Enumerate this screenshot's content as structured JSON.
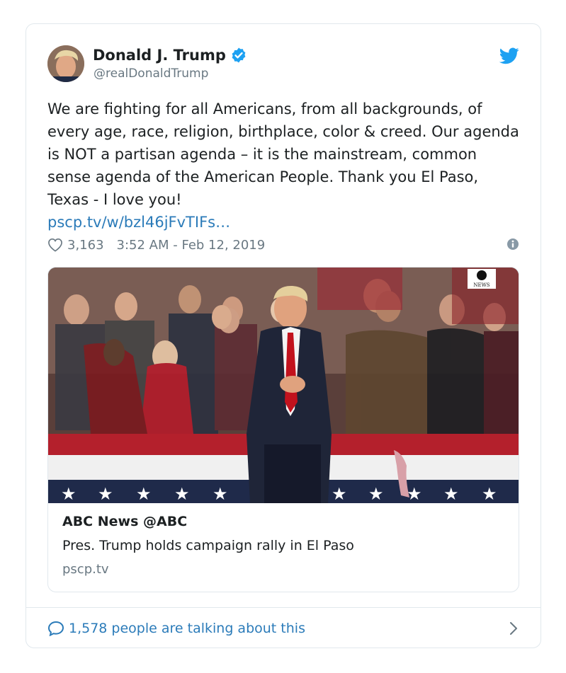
{
  "author": {
    "name": "Donald J. Trump",
    "handle": "@realDonaldTrump"
  },
  "tweet": {
    "text": "We are fighting for all Americans, from all backgrounds, of every age, race, religion, birthplace, color & creed. Our agenda is NOT a partisan agenda – it is the mainstream, common sense agenda of the American People. Thank you El Paso, Texas - I love you!",
    "link": "pscp.tv/w/bzl46jFvTIFs…",
    "likes": "3,163",
    "timestamp": "3:52 AM - Feb 12, 2019"
  },
  "media": {
    "badge": "NEWS",
    "source": "ABC News @ABC",
    "title": "Pres. Trump holds campaign rally in El Paso",
    "domain": "pscp.tv"
  },
  "footer": {
    "talking": "1,578 people are talking about this"
  },
  "icons": {
    "verified": "verified-badge-icon",
    "bird": "twitter-bird-icon",
    "heart": "heart-icon",
    "info": "info-icon",
    "bubble": "comment-bubble-icon",
    "chevron": "chevron-right-icon"
  },
  "colors": {
    "brand_blue": "#1da1f2",
    "link_blue": "#2b7bb9",
    "text": "#1c2022",
    "muted": "#697882",
    "border": "#e1e8ed"
  }
}
